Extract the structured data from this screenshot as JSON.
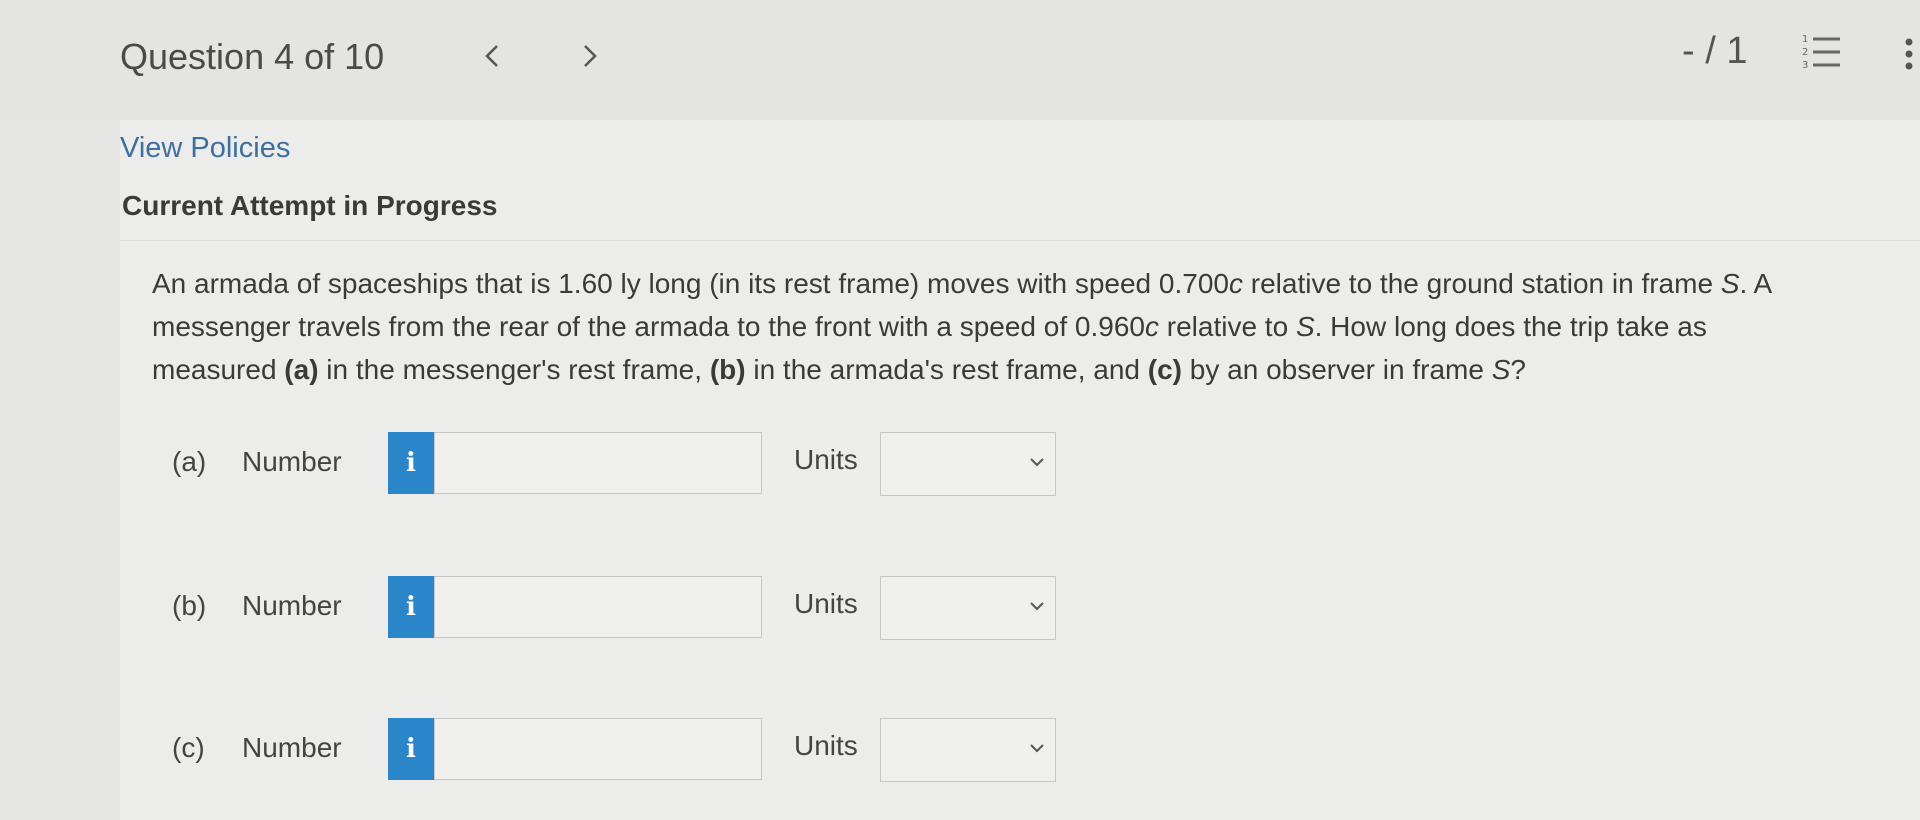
{
  "header": {
    "question_counter": "Question 4 of 10",
    "score": "- / 1"
  },
  "links": {
    "view_policies": "View Policies"
  },
  "status": {
    "attempt": "Current Attempt in Progress"
  },
  "question": {
    "line1": {
      "p1": "An armada of spaceships that is 1.60 ly long (in its rest frame) moves with speed 0.700",
      "c1": "c",
      "p2": " relative to the ground station in frame ",
      "s1": "S",
      "p3": ". A"
    },
    "line2": {
      "p1": "messenger travels from the rear of the armada to the front with a speed of 0.960",
      "c1": "c",
      "p2": " relative to ",
      "s1": "S",
      "p3": ". How long does the trip take as"
    },
    "line3": {
      "p1": "measured ",
      "a": "(a)",
      "p2": " in the messenger's rest frame, ",
      "b": "(b)",
      "p3": " in the armada's rest frame, and ",
      "c": "(c)",
      "p4": " by an observer in frame ",
      "s1": "S",
      "p5": "?"
    }
  },
  "answers": [
    {
      "part": "(a)",
      "number_label": "Number",
      "info_glyph": "i",
      "value": "",
      "units_label": "Units",
      "unit_selected": ""
    },
    {
      "part": "(b)",
      "number_label": "Number",
      "info_glyph": "i",
      "value": "",
      "units_label": "Units",
      "unit_selected": ""
    },
    {
      "part": "(c)",
      "number_label": "Number",
      "info_glyph": "i",
      "value": "",
      "units_label": "Units",
      "unit_selected": ""
    }
  ],
  "icons": {
    "prev": "chevron-left-icon",
    "next": "chevron-right-icon",
    "list": "numbered-list-icon",
    "more": "more-vertical-icon",
    "dropdown": "chevron-down-icon",
    "info": "info-icon"
  },
  "colors": {
    "link": "#3d6fa0",
    "info_button": "#2a86c9",
    "background": "#e6e6e4"
  }
}
